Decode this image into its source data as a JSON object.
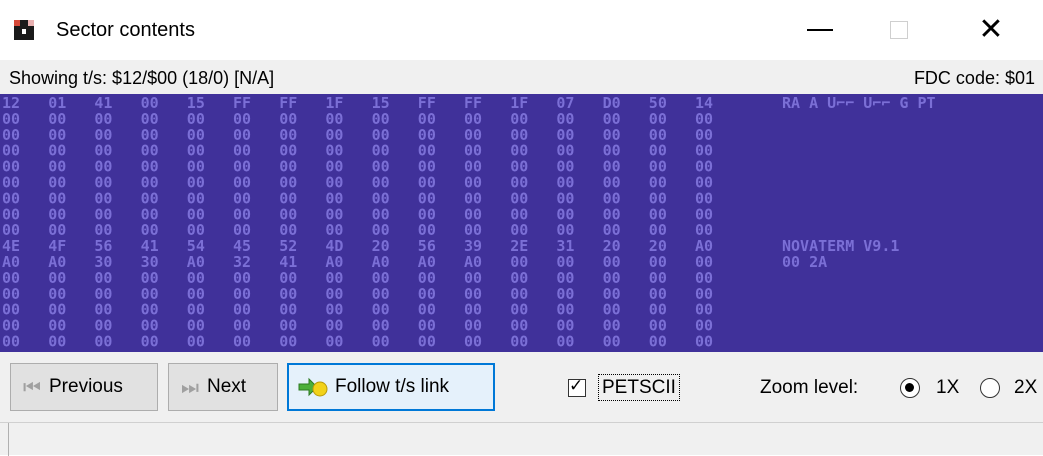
{
  "window": {
    "title": "Sector contents",
    "minimize_icon": "minimize-icon",
    "maximize_icon": "maximize-icon",
    "close_icon": "close-icon",
    "close_glyph": "✕"
  },
  "info": {
    "showing": "Showing t/s: $12/$00 (18/0) [N/A]",
    "fdc_code": "FDC code: $01"
  },
  "hex_view": {
    "background": "#40319a",
    "foreground": "#7b6fd6",
    "rows": [
      "12 01 41 00 15 FF FF 1F 15 FF FF 1F 07 D0 50 14",
      "00 00 00 00 00 00 00 00 00 00 00 00 00 00 00 00",
      "00 00 00 00 00 00 00 00 00 00 00 00 00 00 00 00",
      "00 00 00 00 00 00 00 00 00 00 00 00 00 00 00 00",
      "00 00 00 00 00 00 00 00 00 00 00 00 00 00 00 00",
      "00 00 00 00 00 00 00 00 00 00 00 00 00 00 00 00",
      "00 00 00 00 00 00 00 00 00 00 00 00 00 00 00 00",
      "00 00 00 00 00 00 00 00 00 00 00 00 00 00 00 00",
      "00 00 00 00 00 00 00 00 00 00 00 00 00 00 00 00",
      "4E 4F 56 41 54 45 52 4D 20 56 39 2E 31 20 20 A0",
      "A0 A0 30 30 A0 32 41 A0 A0 A0 A0 00 00 00 00 00",
      "00 00 00 00 00 00 00 00 00 00 00 00 00 00 00 00",
      "00 00 00 00 00 00 00 00 00 00 00 00 00 00 00 00",
      "00 00 00 00 00 00 00 00 00 00 00 00 00 00 00 00",
      "00 00 00 00 00 00 00 00 00 00 00 00 00 00 00 00",
      "00 00 00 00 00 00 00 00 00 00 00 00 00 00 00 00"
    ],
    "ascii_rows": [
      "RA A  U⌐⌐ U⌐⌐ G PT",
      "",
      "",
      "",
      "",
      "",
      "",
      "",
      "",
      "NOVATERM V9.1",
      " 00 2A",
      "",
      "",
      "",
      "",
      ""
    ]
  },
  "toolbar": {
    "previous_label": "Previous",
    "next_label": "Next",
    "follow_label": "Follow t/s link",
    "petscii_label": "PETSCII",
    "petscii_checked": true,
    "zoom_label": "Zoom level:",
    "zoom_options": [
      "1X",
      "2X"
    ],
    "zoom_selected": "1X"
  },
  "status": {
    "text": ""
  }
}
